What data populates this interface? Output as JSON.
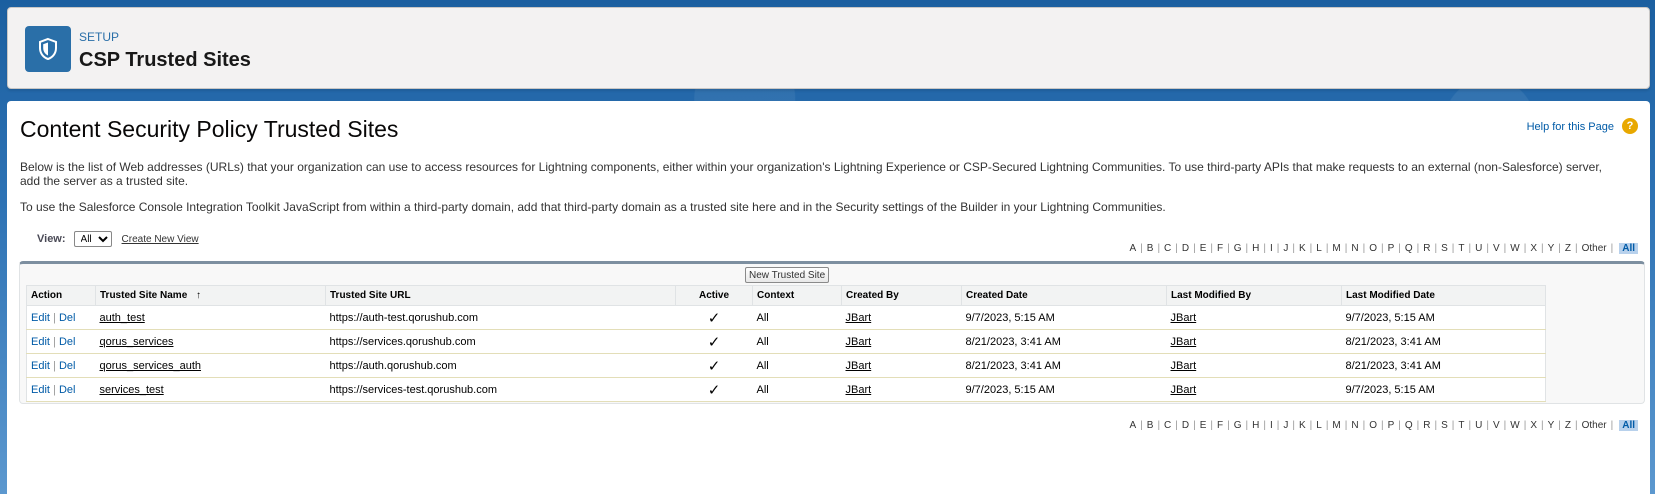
{
  "header": {
    "eyebrow": "SETUP",
    "title": "CSP Trusted Sites"
  },
  "page": {
    "title": "Content Security Policy Trusted Sites",
    "help_link": "Help for this Page",
    "help_icon": "?",
    "description_1": "Below is the list of Web addresses (URLs) that your organization can use to access resources for Lightning components, either within your organization's Lightning Experience or CSP-Secured Lightning Communities. To use third-party APIs that make requests to an external (non-Salesforce) server, add the server as a trusted site.",
    "description_2": "To use the Salesforce Console Integration Toolkit JavaScript from within a third-party domain, add that third-party domain as a trusted site here and in the Security settings of the Builder in your Lightning Communities."
  },
  "view": {
    "label": "View:",
    "selected": "All",
    "create_new_view": "Create New View"
  },
  "alpha_filter": [
    "A",
    "B",
    "C",
    "D",
    "E",
    "F",
    "G",
    "H",
    "I",
    "J",
    "K",
    "L",
    "M",
    "N",
    "O",
    "P",
    "Q",
    "R",
    "S",
    "T",
    "U",
    "V",
    "W",
    "X",
    "Y",
    "Z",
    "Other"
  ],
  "alpha_all": "All",
  "table": {
    "new_button": "New Trusted Site",
    "columns": {
      "action": "Action",
      "name": "Trusted Site Name",
      "sort_indicator": "↑",
      "url": "Trusted Site URL",
      "active": "Active",
      "context": "Context",
      "created_by": "Created By",
      "created_date": "Created Date",
      "last_modified_by": "Last Modified By",
      "last_modified_date": "Last Modified Date"
    },
    "edit_label": "Edit",
    "del_label": "Del",
    "rows": [
      {
        "name": "auth_test",
        "url": "https://auth-test.qorushub.com",
        "active": "✓",
        "context": "All",
        "created_by": "JBart",
        "created_date": "9/7/2023, 5:15 AM",
        "last_modified_by": "JBart",
        "last_modified_date": "9/7/2023, 5:15 AM"
      },
      {
        "name": "qorus_services",
        "url": "https://services.qorushub.com",
        "active": "✓",
        "context": "All",
        "created_by": "JBart",
        "created_date": "8/21/2023, 3:41 AM",
        "last_modified_by": "JBart",
        "last_modified_date": "8/21/2023, 3:41 AM"
      },
      {
        "name": "qorus_services_auth",
        "url": "https://auth.qorushub.com",
        "active": "✓",
        "context": "All",
        "created_by": "JBart",
        "created_date": "8/21/2023, 3:41 AM",
        "last_modified_by": "JBart",
        "last_modified_date": "8/21/2023, 3:41 AM"
      },
      {
        "name": "services_test",
        "url": "https://services-test.qorushub.com",
        "active": "✓",
        "context": "All",
        "created_by": "JBart",
        "created_date": "9/7/2023, 5:15 AM",
        "last_modified_by": "JBart",
        "last_modified_date": "9/7/2023, 5:15 AM"
      }
    ]
  },
  "colors": {
    "brand_blue": "#2a6fa8",
    "link_blue": "#015ba7",
    "help_orange": "#e8a800"
  },
  "icons": {
    "header": "shield-icon",
    "help": "help-icon",
    "check": "check-icon"
  }
}
